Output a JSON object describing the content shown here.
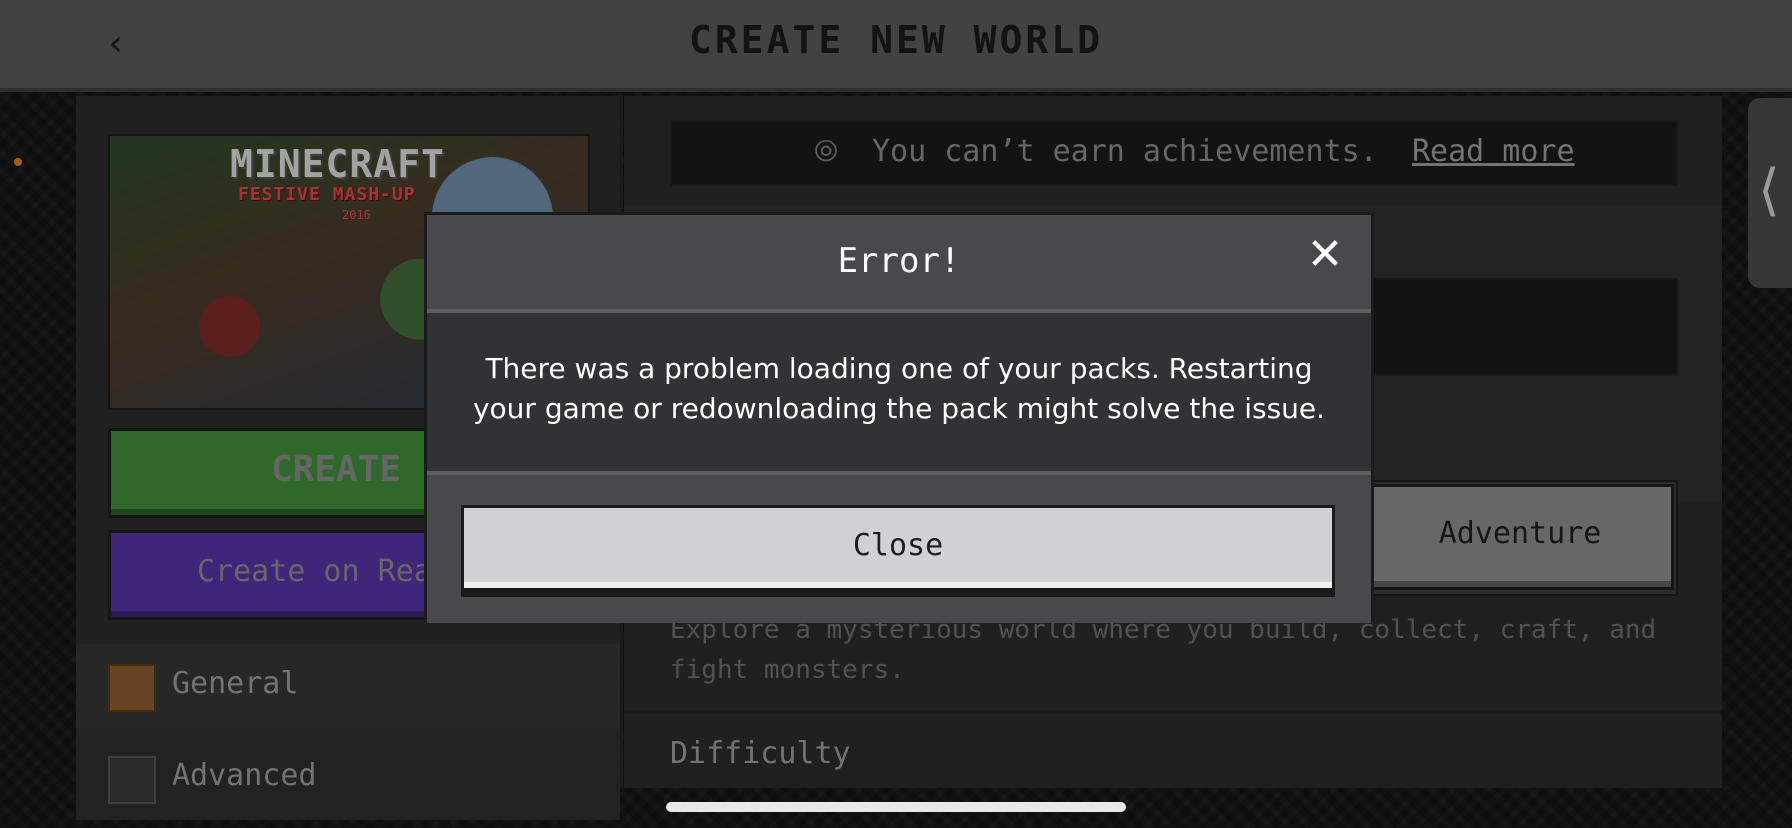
{
  "header": {
    "title": "CREATE NEW WORLD",
    "back_icon": "chevron-left-icon"
  },
  "left_panel": {
    "thumbnail": {
      "logo": "MINECRAFT",
      "subtitle": "FESTIVE MASH-UP",
      "year": "2016"
    },
    "create_button": "CREATE",
    "realms_button": "Create on Rea",
    "menu": [
      {
        "label": "General",
        "icon": "gear-icon"
      },
      {
        "label": "Advanced",
        "icon": "advanced-icon"
      }
    ]
  },
  "right_panel": {
    "achievements_text": "You can’t earn achievements.",
    "achievements_link": "Read more",
    "game_mode_selected": "Adventure",
    "mode_description": "Explore a mysterious world where you build, collect, craft, and fight monsters.",
    "difficulty_label": "Difficulty"
  },
  "dialog": {
    "title": "Error!",
    "message": "There was a problem loading one of your packs. Restarting your game or redownloading the pack might solve the issue.",
    "close_button": "Close"
  },
  "colors": {
    "create": "#3e8c3a",
    "realms": "#5433a5",
    "header": "#595959",
    "dialog_header": "#48494a"
  }
}
